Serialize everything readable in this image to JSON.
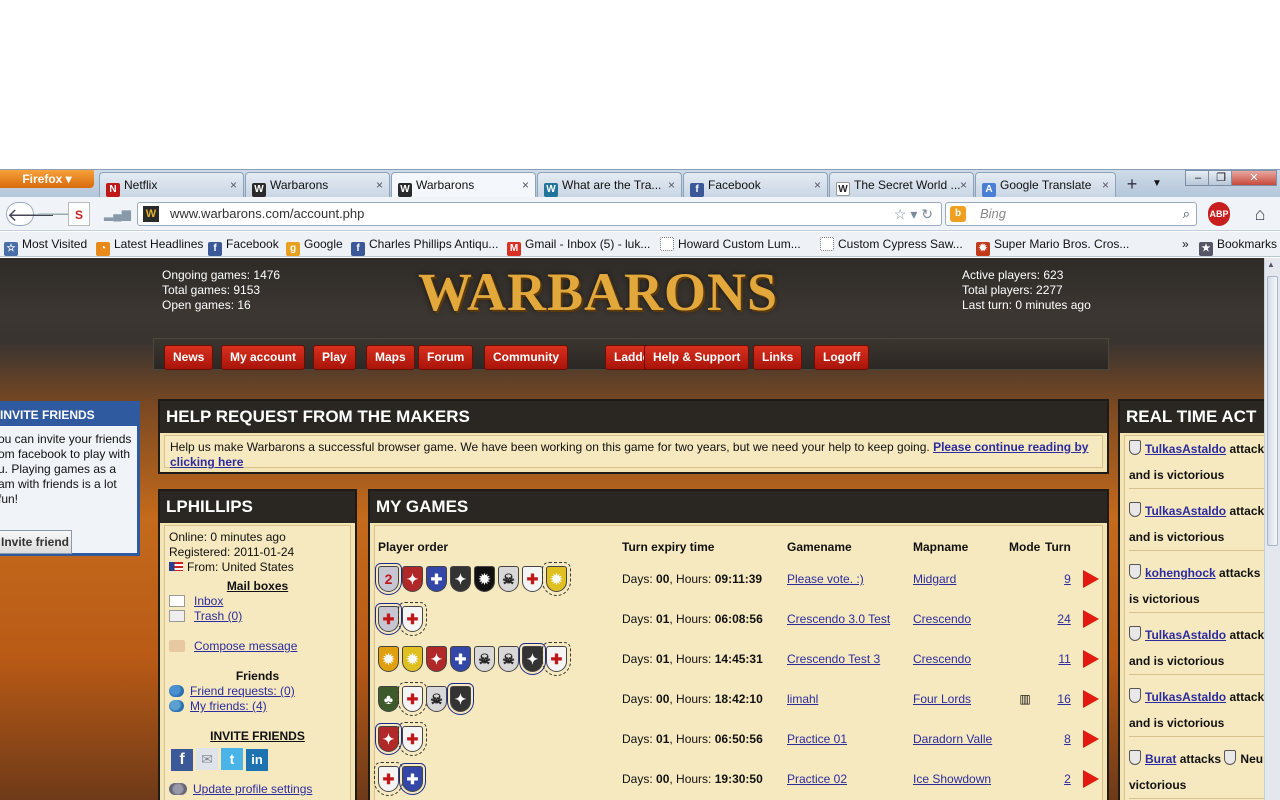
{
  "browser": {
    "menu_button": "Firefox",
    "tabs": [
      {
        "title": "Netflix",
        "icon": "netflix-icon",
        "color": "#c0171a",
        "glyph": "N"
      },
      {
        "title": "Warbarons",
        "icon": "warbarons-icon",
        "color": "#2a2a2a",
        "glyph": "W"
      },
      {
        "title": "Warbarons",
        "icon": "warbarons-icon",
        "color": "#2a2a2a",
        "glyph": "W",
        "active": true
      },
      {
        "title": "What are the Tra...",
        "icon": "wordpress-icon",
        "color": "#21759b",
        "glyph": "W"
      },
      {
        "title": "Facebook",
        "icon": "facebook-icon",
        "color": "#3b5998",
        "glyph": "f"
      },
      {
        "title": "The Secret World ...",
        "icon": "wikipedia-icon",
        "color": "#ffffff",
        "glyph": "W"
      },
      {
        "title": "Google Translate",
        "icon": "google-translate-icon",
        "color": "#4a7fd4",
        "glyph": "A"
      }
    ],
    "url": "www.warbarons.com/account.php",
    "search_placeholder": "Bing",
    "bookmarks": [
      {
        "label": "Most Visited",
        "color": "#4a6fa8",
        "glyph": "☆"
      },
      {
        "label": "Latest Headlines",
        "color": "#e88a1a",
        "glyph": "◔"
      },
      {
        "label": "Facebook",
        "color": "#3b5998",
        "glyph": "f"
      },
      {
        "label": "Google",
        "color": "#e8a020",
        "glyph": "g"
      },
      {
        "label": "Charles Phillips Antiqu...",
        "color": "#3b5998",
        "glyph": "f"
      },
      {
        "label": "Gmail - Inbox (5) - luk...",
        "color": "#d93025",
        "glyph": "M"
      },
      {
        "label": "Howard Custom Lum...",
        "color": "#ffffff",
        "glyph": ""
      },
      {
        "label": "Custom Cypress Saw...",
        "color": "#ffffff",
        "glyph": ""
      },
      {
        "label": "Super Mario Bros. Cros...",
        "color": "#c23a1a",
        "glyph": "✹"
      }
    ],
    "bookmarks_menu": "Bookmarks"
  },
  "site": {
    "logo": "WARBARONS",
    "stats_left": [
      "Ongoing games: 1476",
      "Total games: 9153",
      "Open games: 16"
    ],
    "stats_right": [
      "Active players: 623",
      "Total players: 2277",
      "Last turn: 0 minutes ago"
    ],
    "menu": [
      "News",
      "My account",
      "Play",
      "Maps",
      "Forum",
      "Community",
      "Ladder",
      "Help & Support",
      "Links",
      "Logoff"
    ]
  },
  "invite_friends": {
    "title": "INVITE FRIENDS",
    "text": "ou can invite your friends\nom facebook to play with\nu. Playing games as a\nam with friends is a lot\nfun!",
    "button": "Invite friend"
  },
  "help_request": {
    "title": "HELP REQUEST FROM THE MAKERS",
    "text": "Help us make Warbarons a successful browser game. We have been working on this game for two years, but we need your help to keep going. ",
    "link": "Please continue reading by clicking here"
  },
  "profile": {
    "title": "LPHILLIPS",
    "online": "Online: 0 minutes ago",
    "registered": "Registered: 2011-01-24",
    "from": "From: United States",
    "mailboxes_title": "Mail boxes",
    "inbox": "Inbox",
    "trash": "Trash (0)",
    "compose": "Compose message",
    "friends_title": "Friends",
    "friend_requests": "Friend requests: (0)",
    "my_friends": "My friends: (4)",
    "invite_title": "INVITE FRIENDS",
    "update_settings": "Update profile settings"
  },
  "my_games": {
    "title": "MY GAMES",
    "headers": {
      "player_order": "Player order",
      "turn_expiry": "Turn expiry time",
      "gamename": "Gamename",
      "mapname": "Mapname",
      "mode": "Mode",
      "turn": "Turn"
    },
    "rows": [
      {
        "shields": [
          {
            "c": "#c7c7d4",
            "g": "2",
            "sel": true
          },
          {
            "c": "#b02828",
            "g": "✦"
          },
          {
            "c": "#3347a8",
            "g": "✚"
          },
          {
            "c": "#333",
            "g": "✦"
          },
          {
            "c": "#111",
            "g": "✹"
          },
          {
            "c": "#d8d8d8",
            "g": "☠"
          },
          {
            "c": "#f4f4f4",
            "g": "✚"
          },
          {
            "c": "#e0c020",
            "g": "✹",
            "dash": true
          }
        ],
        "days": "00",
        "hours": "09:11:39",
        "game": "Please vote. :)",
        "map": "Midgard",
        "mode": "",
        "turn": "9"
      },
      {
        "shields": [
          {
            "c": "#c7c7d4",
            "g": "✚",
            "sel": true
          },
          {
            "c": "#f4f4f4",
            "g": "✚",
            "dash": true
          }
        ],
        "days": "01",
        "hours": "06:08:56",
        "game": "Crescendo 3.0 Test",
        "map": "Crescendo",
        "mode": "",
        "turn": "24"
      },
      {
        "shields": [
          {
            "c": "#e0a010",
            "g": "✹"
          },
          {
            "c": "#e0c020",
            "g": "✹"
          },
          {
            "c": "#b02828",
            "g": "✦"
          },
          {
            "c": "#3347a8",
            "g": "✚"
          },
          {
            "c": "#d8d8d8",
            "g": "☠"
          },
          {
            "c": "#d8d8d8",
            "g": "☠"
          },
          {
            "c": "#333",
            "g": "✦",
            "sel": true
          },
          {
            "c": "#f4f4f4",
            "g": "✚",
            "dash": true
          }
        ],
        "days": "01",
        "hours": "14:45:31",
        "game": "Crescendo Test 3",
        "map": "Crescendo",
        "mode": "",
        "turn": "11"
      },
      {
        "shields": [
          {
            "c": "#3d5a2a",
            "g": "♣"
          },
          {
            "c": "#f4f4f4",
            "g": "✚",
            "dash": true
          },
          {
            "c": "#d8d8d8",
            "g": "☠"
          },
          {
            "c": "#333",
            "g": "✦",
            "sel": true
          }
        ],
        "days": "00",
        "hours": "18:42:10",
        "game": "limahl",
        "map": "Four Lords",
        "mode": "▥",
        "turn": "16"
      },
      {
        "shields": [
          {
            "c": "#b02828",
            "g": "✦",
            "sel": true
          },
          {
            "c": "#f4f4f4",
            "g": "✚",
            "dash": true
          }
        ],
        "days": "01",
        "hours": "06:50:56",
        "game": "Practice 01",
        "map": "Daradorn Valle",
        "mode": "",
        "turn": "8"
      },
      {
        "shields": [
          {
            "c": "#f4f4f4",
            "g": "✚",
            "dash": true
          },
          {
            "c": "#3347a8",
            "g": "✚",
            "sel": true
          }
        ],
        "days": "00",
        "hours": "19:30:50",
        "game": "Practice 02",
        "map": "Ice Showdown",
        "mode": "",
        "turn": "2"
      }
    ]
  },
  "realtime": {
    "title": "REAL TIME ACT",
    "items": [
      {
        "player": "TulkasAstaldo",
        "action": "attack",
        "line2": "and is victorious"
      },
      {
        "player": "TulkasAstaldo",
        "action": "attack",
        "line2": "and is victorious"
      },
      {
        "player": "kohenghock",
        "action": "attacks",
        "line2": "is victorious"
      },
      {
        "player": "TulkasAstaldo",
        "action": "attack",
        "line2": "and is victorious"
      },
      {
        "player": "TulkasAstaldo",
        "action": "attack",
        "line2": "and is victorious"
      },
      {
        "player": "Burat",
        "action": "attacks",
        "extra": "Neu",
        "line2": "victorious"
      }
    ]
  }
}
